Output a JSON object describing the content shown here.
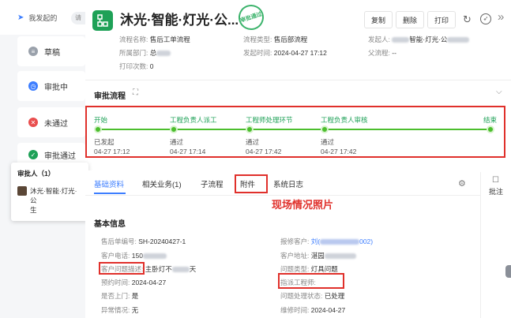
{
  "nav": {
    "top_label": "我发起的",
    "pill_label": "请"
  },
  "sidebar": {
    "items": [
      {
        "label": "草稿",
        "color": "#9aa1ab",
        "icon": "draft-icon"
      },
      {
        "label": "审批中",
        "color": "#3d7eff",
        "icon": "clock-icon"
      },
      {
        "label": "未通过",
        "color": "#e94e4e",
        "icon": "cross-icon"
      },
      {
        "label": "审批通过",
        "color": "#1ea157",
        "icon": "check-icon"
      }
    ]
  },
  "approver": {
    "title": "审批人（1）",
    "name": "沐光·智能·灯光·公",
    "name2": "生"
  },
  "header": {
    "title": "沐光·智能·灯光·公...",
    "stamp": "审批通过",
    "buttons": {
      "copy": "复制",
      "delete": "删除",
      "print": "打印"
    },
    "fields": {
      "process_name_k": "流程名称:",
      "process_name_v": "售后工单流程",
      "process_type_k": "流程类型:",
      "process_type_v": "售后部流程",
      "initiator_k": "发起人:",
      "initiator_v": "智能·灯光·公",
      "dept_k": "所属部门:",
      "dept_v": "总",
      "time_k": "发起时间:",
      "time_v": "2024-04-27 17:12",
      "parent_k": "父流程:",
      "parent_v": "--",
      "print_k": "打印次数:",
      "print_v": "0"
    }
  },
  "flow": {
    "title": "审批流程",
    "steps": [
      {
        "label": "开始",
        "status": "已发起",
        "time": "04-27 17:12"
      },
      {
        "label": "工程负责人派工",
        "status": "通过",
        "time": "04-27 17:14"
      },
      {
        "label": "工程师处理环节",
        "status": "通过",
        "time": "04-27 17:42"
      },
      {
        "label": "工程负责人审核",
        "status": "通过",
        "time": "04-27 17:42"
      },
      {
        "label": "结束",
        "status": "",
        "time": ""
      }
    ]
  },
  "tabs": {
    "basic": "基础资料",
    "related": "相关业务(1)",
    "sub": "子流程",
    "attach": "附件",
    "log": "系统日志"
  },
  "annotation": "现场情况照片",
  "info": {
    "title": "基本信息",
    "rows": [
      {
        "k1": "售后单编号:",
        "v1": "SH-20240427-1",
        "k2": "报修客户:",
        "v2": "刘(",
        "v2b": "002)"
      },
      {
        "k1": "客户电话:",
        "v1": "150",
        "k2": "客户地址:",
        "v2": "湛园"
      },
      {
        "k1": "客户问题描述:",
        "v1": "主卧灯不",
        "v1b": "天",
        "k2": "问题类型:",
        "v2": "灯具问题"
      },
      {
        "k1": "预约时间:",
        "v1": "2024-04-27",
        "k2": "指派工程师:",
        "v2": ""
      },
      {
        "k1": "是否上门:",
        "v1": "是",
        "k2": "问题处理状态:",
        "v2": "已处理"
      },
      {
        "k1": "异常情况:",
        "v1": "无",
        "k2": "维修时间:",
        "v2": "2024-04-27"
      }
    ]
  },
  "right_panel": {
    "comment": "批注"
  }
}
